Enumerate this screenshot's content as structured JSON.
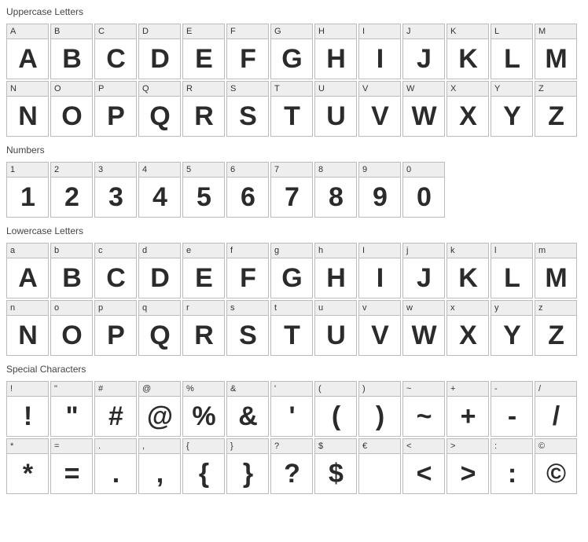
{
  "sections": [
    {
      "title": "Uppercase Letters",
      "id": "uppercase",
      "cells": [
        {
          "label": "A",
          "glyph": "A"
        },
        {
          "label": "B",
          "glyph": "B"
        },
        {
          "label": "C",
          "glyph": "C"
        },
        {
          "label": "D",
          "glyph": "D"
        },
        {
          "label": "E",
          "glyph": "E"
        },
        {
          "label": "F",
          "glyph": "F"
        },
        {
          "label": "G",
          "glyph": "G"
        },
        {
          "label": "H",
          "glyph": "H"
        },
        {
          "label": "I",
          "glyph": "I"
        },
        {
          "label": "J",
          "glyph": "J"
        },
        {
          "label": "K",
          "glyph": "K"
        },
        {
          "label": "L",
          "glyph": "L"
        },
        {
          "label": "M",
          "glyph": "M"
        },
        {
          "label": "N",
          "glyph": "N"
        },
        {
          "label": "O",
          "glyph": "O"
        },
        {
          "label": "P",
          "glyph": "P"
        },
        {
          "label": "Q",
          "glyph": "Q"
        },
        {
          "label": "R",
          "glyph": "R"
        },
        {
          "label": "S",
          "glyph": "S"
        },
        {
          "label": "T",
          "glyph": "T"
        },
        {
          "label": "U",
          "glyph": "U"
        },
        {
          "label": "V",
          "glyph": "V"
        },
        {
          "label": "W",
          "glyph": "W"
        },
        {
          "label": "X",
          "glyph": "X"
        },
        {
          "label": "Y",
          "glyph": "Y"
        },
        {
          "label": "Z",
          "glyph": "Z"
        }
      ]
    },
    {
      "title": "Numbers",
      "id": "numbers",
      "cells": [
        {
          "label": "1",
          "glyph": "1"
        },
        {
          "label": "2",
          "glyph": "2"
        },
        {
          "label": "3",
          "glyph": "3"
        },
        {
          "label": "4",
          "glyph": "4"
        },
        {
          "label": "5",
          "glyph": "5"
        },
        {
          "label": "6",
          "glyph": "6"
        },
        {
          "label": "7",
          "glyph": "7"
        },
        {
          "label": "8",
          "glyph": "8"
        },
        {
          "label": "9",
          "glyph": "9"
        },
        {
          "label": "0",
          "glyph": "0"
        }
      ]
    },
    {
      "title": "Lowercase Letters",
      "id": "lowercase",
      "cells": [
        {
          "label": "a",
          "glyph": "A"
        },
        {
          "label": "b",
          "glyph": "B"
        },
        {
          "label": "c",
          "glyph": "C"
        },
        {
          "label": "d",
          "glyph": "D"
        },
        {
          "label": "e",
          "glyph": "E"
        },
        {
          "label": "f",
          "glyph": "F"
        },
        {
          "label": "g",
          "glyph": "G"
        },
        {
          "label": "h",
          "glyph": "H"
        },
        {
          "label": "I",
          "glyph": "I"
        },
        {
          "label": "j",
          "glyph": "J"
        },
        {
          "label": "k",
          "glyph": "K"
        },
        {
          "label": "l",
          "glyph": "L"
        },
        {
          "label": "m",
          "glyph": "M"
        },
        {
          "label": "n",
          "glyph": "N"
        },
        {
          "label": "o",
          "glyph": "O"
        },
        {
          "label": "p",
          "glyph": "P"
        },
        {
          "label": "q",
          "glyph": "Q"
        },
        {
          "label": "r",
          "glyph": "R"
        },
        {
          "label": "s",
          "glyph": "S"
        },
        {
          "label": "t",
          "glyph": "T"
        },
        {
          "label": "u",
          "glyph": "U"
        },
        {
          "label": "v",
          "glyph": "V"
        },
        {
          "label": "w",
          "glyph": "W"
        },
        {
          "label": "x",
          "glyph": "X"
        },
        {
          "label": "y",
          "glyph": "Y"
        },
        {
          "label": "z",
          "glyph": "Z"
        }
      ]
    },
    {
      "title": "Special Characters",
      "id": "special",
      "cells": [
        {
          "label": "!",
          "glyph": "!"
        },
        {
          "label": "\"",
          "glyph": "\""
        },
        {
          "label": "#",
          "glyph": "#"
        },
        {
          "label": "@",
          "glyph": "@"
        },
        {
          "label": "%",
          "glyph": "%"
        },
        {
          "label": "&",
          "glyph": "&"
        },
        {
          "label": "'",
          "glyph": "'"
        },
        {
          "label": "(",
          "glyph": "("
        },
        {
          "label": ")",
          "glyph": ")"
        },
        {
          "label": "~",
          "glyph": "~"
        },
        {
          "label": "+",
          "glyph": "+"
        },
        {
          "label": "-",
          "glyph": "-"
        },
        {
          "label": "/",
          "glyph": "/"
        },
        {
          "label": "*",
          "glyph": "*"
        },
        {
          "label": "=",
          "glyph": "="
        },
        {
          "label": ".",
          "glyph": "."
        },
        {
          "label": ",",
          "glyph": ","
        },
        {
          "label": "{",
          "glyph": "{"
        },
        {
          "label": "}",
          "glyph": "}"
        },
        {
          "label": "?",
          "glyph": "?"
        },
        {
          "label": "$",
          "glyph": "$"
        },
        {
          "label": "€",
          "glyph": ""
        },
        {
          "label": "<",
          "glyph": "<"
        },
        {
          "label": ">",
          "glyph": ">"
        },
        {
          "label": ":",
          "glyph": ":"
        },
        {
          "label": "©",
          "glyph": "©"
        }
      ]
    }
  ]
}
